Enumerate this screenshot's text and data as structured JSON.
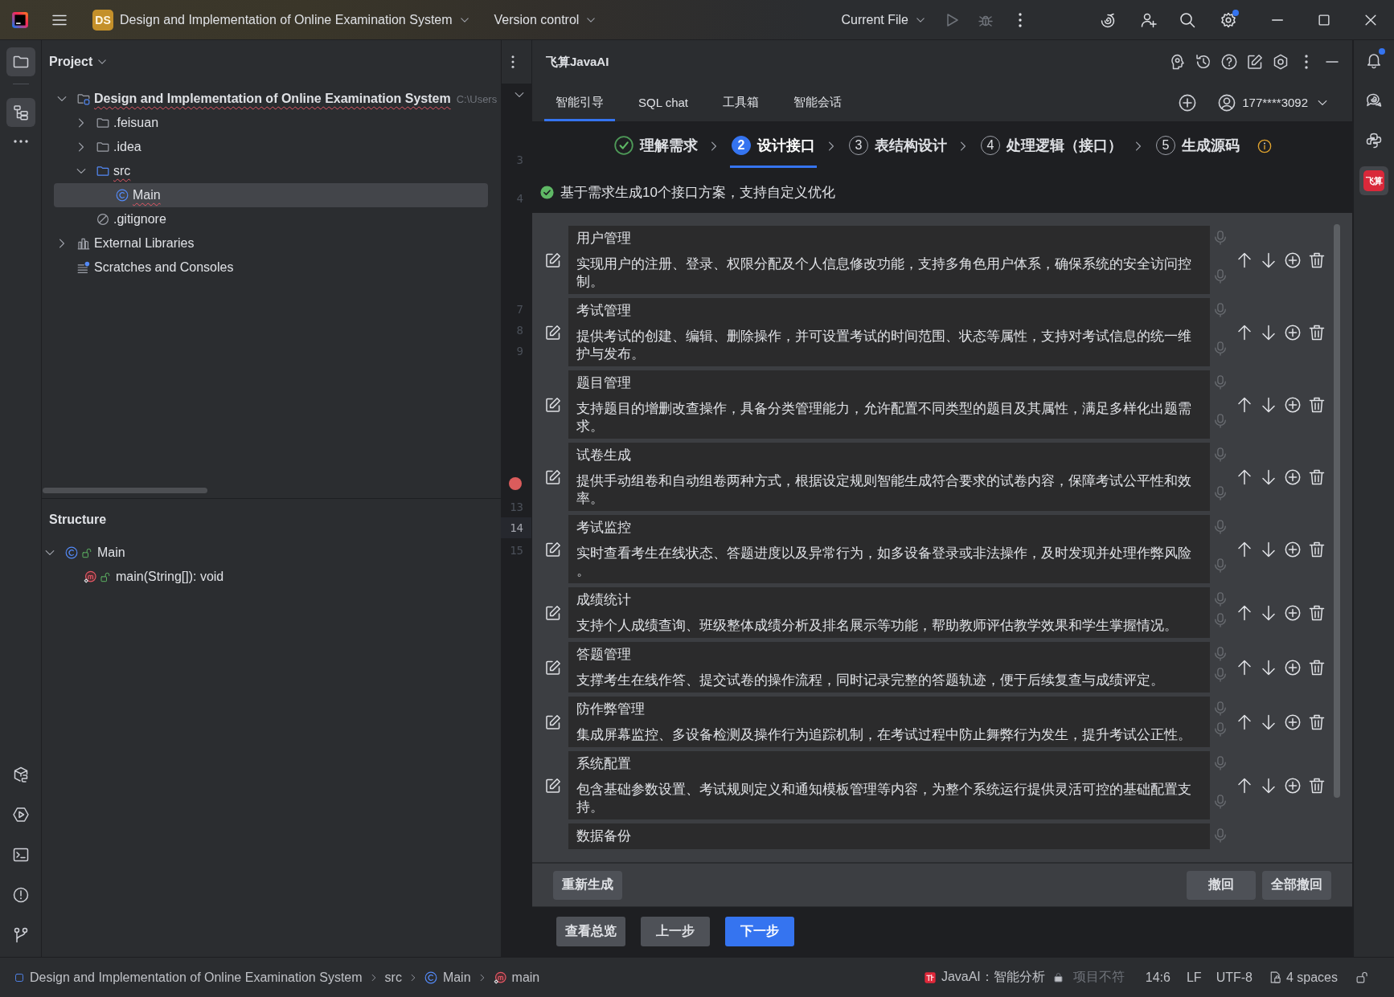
{
  "title_bar": {
    "project_badge": "DS",
    "project_name": "Design and Implementation of Online Examination System",
    "vcs": "Version control",
    "run_config": "Current File",
    "run_enabled": false,
    "settings_dot": true
  },
  "left_toolbar": {
    "top": [
      {
        "kind": "project",
        "selected": true
      },
      {
        "kind": "structure",
        "selected": true
      },
      {
        "kind": "more",
        "selected": false
      }
    ],
    "bottom": [
      {
        "kind": "packages",
        "selected": false
      },
      {
        "kind": "services",
        "selected": false
      },
      {
        "kind": "terminal",
        "selected": false
      },
      {
        "kind": "problems",
        "selected": false
      },
      {
        "kind": "git",
        "selected": false
      }
    ]
  },
  "project_panel": {
    "title": "Project",
    "tree": [
      {
        "label": "Design and Implementation of Online Examination System",
        "path": "C:\\Users",
        "kind": "module",
        "expanded": true,
        "selected": false,
        "error": true,
        "children": [
          {
            "label": ".feisuan",
            "kind": "folder",
            "expanded": false,
            "selected": false,
            "error": false
          },
          {
            "label": ".idea",
            "kind": "folder",
            "expanded": false,
            "selected": false,
            "error": false
          },
          {
            "label": "src",
            "kind": "source-folder",
            "expanded": true,
            "selected": false,
            "error": true,
            "children": [
              {
                "label": "Main",
                "kind": "class",
                "selected": true,
                "error": true
              }
            ]
          },
          {
            "label": ".gitignore",
            "kind": "ignore",
            "selected": false,
            "error": false
          }
        ]
      },
      {
        "label": "External Libraries",
        "kind": "library",
        "expanded": false,
        "selected": false,
        "error": false
      },
      {
        "label": "Scratches and Consoles",
        "kind": "scratches",
        "selected": false,
        "error": false
      }
    ]
  },
  "structure_panel": {
    "title": "Structure",
    "tree": [
      {
        "label": "Main",
        "kind": "class",
        "public": true,
        "expanded": true,
        "selected": false,
        "children": [
          {
            "label": "main(String[]): void",
            "kind": "method",
            "public": true,
            "selected": false
          }
        ]
      }
    ]
  },
  "editor_gutter": {
    "lines": [
      {
        "number": "3",
        "current": false,
        "breakpoint": false
      },
      {
        "number": "4",
        "current": false,
        "breakpoint": false
      },
      {
        "number": "7",
        "current": false,
        "breakpoint": false
      },
      {
        "number": "8",
        "current": false,
        "breakpoint": false
      },
      {
        "number": "9",
        "current": false,
        "breakpoint": false
      },
      {
        "current": false,
        "breakpoint": true
      },
      {
        "number": "13",
        "current": false,
        "breakpoint": false
      },
      {
        "number": "14",
        "current": true,
        "breakpoint": false
      },
      {
        "number": "15",
        "current": false,
        "breakpoint": false
      }
    ]
  },
  "ai_panel": {
    "title": "飞算JavaAI",
    "tabs": [
      {
        "label": "智能引导",
        "selected": true
      },
      {
        "label": "SQL chat",
        "selected": false
      },
      {
        "label": "工具箱",
        "selected": false
      },
      {
        "label": "智能会话",
        "selected": false
      }
    ],
    "account": "177****3092",
    "steps": [
      {
        "label": "理解需求",
        "done": true,
        "selected": false
      },
      {
        "number": "2",
        "label": "设计接口",
        "done": false,
        "selected": true
      },
      {
        "number": "3",
        "label": "表结构设计",
        "done": false,
        "selected": false
      },
      {
        "number": "4",
        "label": "处理逻辑（接口）",
        "done": false,
        "selected": false
      },
      {
        "number": "5",
        "label": "生成源码",
        "done": false,
        "selected": false
      }
    ],
    "status": "基于需求生成10个接口方案，支持自定义优化",
    "items": [
      {
        "title": "用户管理",
        "description": "实现用户的注册、登录、权限分配及个人信息修改功能，支持多角色用户体系，确保系统的安全访问控制。"
      },
      {
        "title": "考试管理",
        "description": "提供考试的创建、编辑、删除操作，并可设置考试的时间范围、状态等属性，支持对考试信息的统一维护与发布。"
      },
      {
        "title": "题目管理",
        "description": "支持题目的增删改查操作，具备分类管理能力，允许配置不同类型的题目及其属性，满足多样化出题需求。"
      },
      {
        "title": "试卷生成",
        "description": "提供手动组卷和自动组卷两种方式，根据设定规则智能生成符合要求的试卷内容，保障考试公平性和效率。"
      },
      {
        "title": "考试监控",
        "description": "实时查看考生在线状态、答题进度以及异常行为，如多设备登录或非法操作，及时发现并处理作弊风险。"
      },
      {
        "title": "成绩统计",
        "description": "支持个人成绩查询、班级整体成绩分析及排名展示等功能，帮助教师评估教学效果和学生掌握情况。"
      },
      {
        "title": "答题管理",
        "description": "支撑考生在线作答、提交试卷的操作流程，同时记录完整的答题轨迹，便于后续复查与成绩评定。"
      },
      {
        "title": "防作弊管理",
        "description": "集成屏幕监控、多设备检测及操作行为追踪机制，在考试过程中防止舞弊行为发生，提升考试公正性。"
      },
      {
        "title": "系统配置",
        "description": "包含基础参数设置、考试规则定义和通知模板管理等内容，为整个系统运行提供灵活可控的基础配置支持。"
      },
      {
        "title": "数据备份"
      }
    ],
    "action_bar": {
      "left": [
        "重新生成"
      ],
      "right": [
        "撤回",
        "全部撤回"
      ]
    },
    "footer_buttons": [
      {
        "label": "查看总览",
        "kind": "secondary"
      },
      {
        "label": "上一步",
        "kind": "secondary"
      },
      {
        "label": "下一步",
        "kind": "primary"
      }
    ]
  },
  "right_toolbar": {
    "items": [
      {
        "kind": "notifications",
        "selected": false,
        "dot": true
      },
      {
        "kind": "ai-chat",
        "selected": false,
        "dot": false
      },
      {
        "kind": "python",
        "selected": false,
        "dot": false
      },
      {
        "kind": "plugin",
        "selected": true,
        "dot": false,
        "label": "飞算"
      }
    ]
  },
  "status_bar": {
    "breadcrumbs": [
      {
        "label": "Design and Implementation of Online Examination System",
        "kind": "module"
      },
      {
        "label": "src",
        "kind": "folder"
      },
      {
        "label": "Main",
        "kind": "class"
      },
      {
        "label": "main",
        "kind": "method"
      }
    ],
    "ai_status": "JavaAI：智能分析",
    "project_status": "项目不符",
    "position": "14:6",
    "line_separator": "LF",
    "encoding": "UTF-8",
    "indent": "4 spaces"
  }
}
